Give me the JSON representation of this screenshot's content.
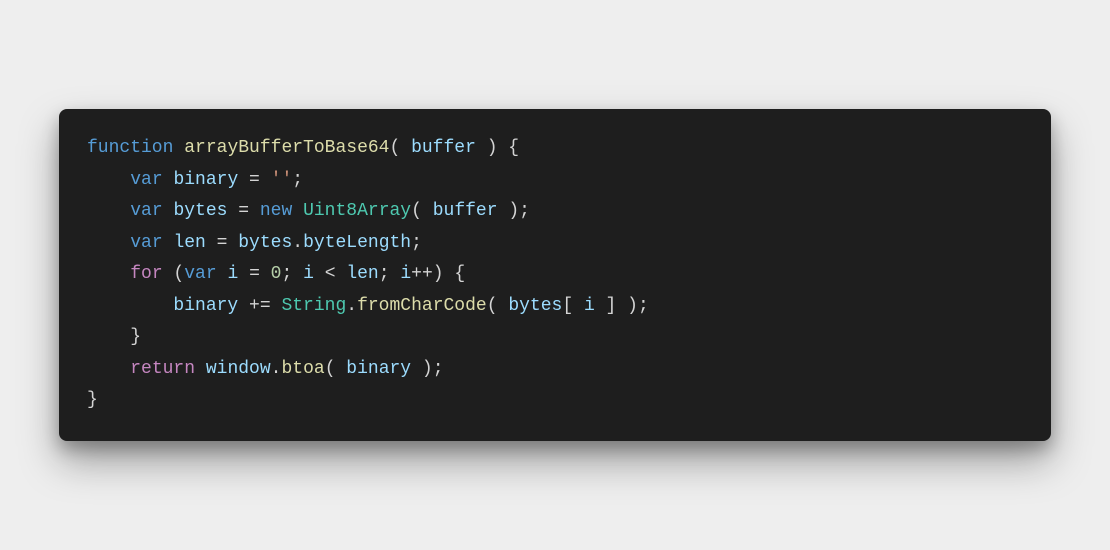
{
  "code": {
    "language": "javascript",
    "tokens": [
      [
        {
          "t": "function",
          "c": "keyword"
        },
        {
          "t": " ",
          "c": "punc"
        },
        {
          "t": "arrayBufferToBase64",
          "c": "func"
        },
        {
          "t": "( ",
          "c": "punc"
        },
        {
          "t": "buffer",
          "c": "var"
        },
        {
          "t": " ) {",
          "c": "punc"
        }
      ],
      [
        {
          "t": "    ",
          "c": "punc"
        },
        {
          "t": "var",
          "c": "keyword"
        },
        {
          "t": " ",
          "c": "punc"
        },
        {
          "t": "binary",
          "c": "var"
        },
        {
          "t": " = ",
          "c": "op"
        },
        {
          "t": "''",
          "c": "string"
        },
        {
          "t": ";",
          "c": "punc"
        }
      ],
      [
        {
          "t": "    ",
          "c": "punc"
        },
        {
          "t": "var",
          "c": "keyword"
        },
        {
          "t": " ",
          "c": "punc"
        },
        {
          "t": "bytes",
          "c": "var"
        },
        {
          "t": " = ",
          "c": "op"
        },
        {
          "t": "new",
          "c": "keyword"
        },
        {
          "t": " ",
          "c": "punc"
        },
        {
          "t": "Uint8Array",
          "c": "type"
        },
        {
          "t": "( ",
          "c": "punc"
        },
        {
          "t": "buffer",
          "c": "var"
        },
        {
          "t": " );",
          "c": "punc"
        }
      ],
      [
        {
          "t": "    ",
          "c": "punc"
        },
        {
          "t": "var",
          "c": "keyword"
        },
        {
          "t": " ",
          "c": "punc"
        },
        {
          "t": "len",
          "c": "var"
        },
        {
          "t": " = ",
          "c": "op"
        },
        {
          "t": "bytes",
          "c": "var"
        },
        {
          "t": ".",
          "c": "punc"
        },
        {
          "t": "byteLength",
          "c": "var"
        },
        {
          "t": ";",
          "c": "punc"
        }
      ],
      [
        {
          "t": "    ",
          "c": "punc"
        },
        {
          "t": "for",
          "c": "keyword2"
        },
        {
          "t": " (",
          "c": "punc"
        },
        {
          "t": "var",
          "c": "keyword"
        },
        {
          "t": " ",
          "c": "punc"
        },
        {
          "t": "i",
          "c": "var"
        },
        {
          "t": " = ",
          "c": "op"
        },
        {
          "t": "0",
          "c": "number"
        },
        {
          "t": "; ",
          "c": "punc"
        },
        {
          "t": "i",
          "c": "var"
        },
        {
          "t": " < ",
          "c": "op"
        },
        {
          "t": "len",
          "c": "var"
        },
        {
          "t": "; ",
          "c": "punc"
        },
        {
          "t": "i",
          "c": "var"
        },
        {
          "t": "++) {",
          "c": "punc"
        }
      ],
      [
        {
          "t": "        ",
          "c": "punc"
        },
        {
          "t": "binary",
          "c": "var"
        },
        {
          "t": " += ",
          "c": "op"
        },
        {
          "t": "String",
          "c": "type"
        },
        {
          "t": ".",
          "c": "punc"
        },
        {
          "t": "fromCharCode",
          "c": "func"
        },
        {
          "t": "( ",
          "c": "punc"
        },
        {
          "t": "bytes",
          "c": "var"
        },
        {
          "t": "[ ",
          "c": "punc"
        },
        {
          "t": "i",
          "c": "var"
        },
        {
          "t": " ] );",
          "c": "punc"
        }
      ],
      [
        {
          "t": "    }",
          "c": "punc"
        }
      ],
      [
        {
          "t": "    ",
          "c": "punc"
        },
        {
          "t": "return",
          "c": "keyword2"
        },
        {
          "t": " ",
          "c": "punc"
        },
        {
          "t": "window",
          "c": "var"
        },
        {
          "t": ".",
          "c": "punc"
        },
        {
          "t": "btoa",
          "c": "func"
        },
        {
          "t": "( ",
          "c": "punc"
        },
        {
          "t": "binary",
          "c": "var"
        },
        {
          "t": " );",
          "c": "punc"
        }
      ],
      [
        {
          "t": "}",
          "c": "punc"
        }
      ]
    ]
  }
}
